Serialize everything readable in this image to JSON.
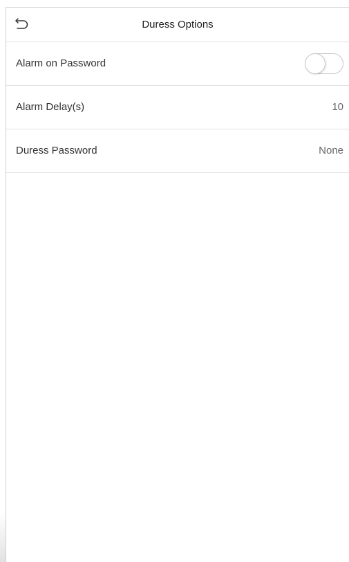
{
  "header": {
    "title": "Duress Options",
    "back_icon": "back-arrow-icon"
  },
  "settings": [
    {
      "label": "Alarm on Password",
      "control": "toggle",
      "enabled": false
    },
    {
      "label": "Alarm Delay(s)",
      "control": "value",
      "value": "10"
    },
    {
      "label": "Duress Password",
      "control": "value",
      "value": "None"
    }
  ],
  "colors": {
    "divider": "#e1e1e1",
    "text_primary": "#333333",
    "text_secondary": "#666666",
    "toggle_border": "#c8c8c8"
  }
}
